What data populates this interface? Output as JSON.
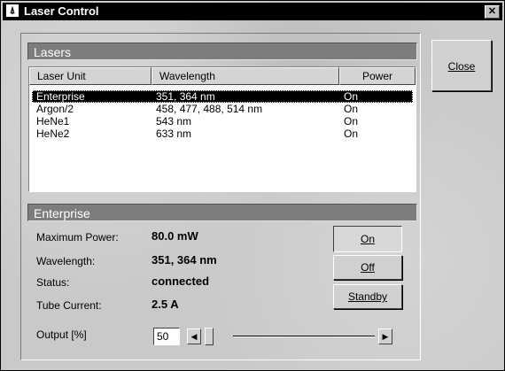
{
  "window": {
    "title": "Laser Control",
    "icon": "laser-app-icon",
    "close_glyph": "✕"
  },
  "lasers": {
    "header": "Lasers",
    "columns": [
      "Laser Unit",
      "Wavelength",
      "Power"
    ],
    "rows": [
      {
        "unit": "Enterprise",
        "wavelength": "351, 364 nm",
        "power": "On",
        "selected": true
      },
      {
        "unit": "Argon/2",
        "wavelength": "458, 477, 488, 514 nm",
        "power": "On",
        "selected": false
      },
      {
        "unit": "HeNe1",
        "wavelength": "543 nm",
        "power": "On",
        "selected": false
      },
      {
        "unit": "HeNe2",
        "wavelength": "633 nm",
        "power": "On",
        "selected": false
      }
    ]
  },
  "detail": {
    "header": "Enterprise",
    "max_power_label": "Maximum Power:",
    "max_power_value": "80.0 mW",
    "wavelength_label": "Wavelength:",
    "wavelength_value": "351, 364 nm",
    "status_label": "Status:",
    "status_value": "connected",
    "tube_current_label": "Tube Current:",
    "tube_current_value": "2.5 A",
    "output_label": "Output [%]",
    "output_value": "50"
  },
  "buttons": {
    "close": "Close",
    "on": "On",
    "off": "Off",
    "standby": "Standby"
  },
  "slider": {
    "value_fraction": 0.0,
    "left_arrow": "◀",
    "right_arrow": "▶"
  }
}
